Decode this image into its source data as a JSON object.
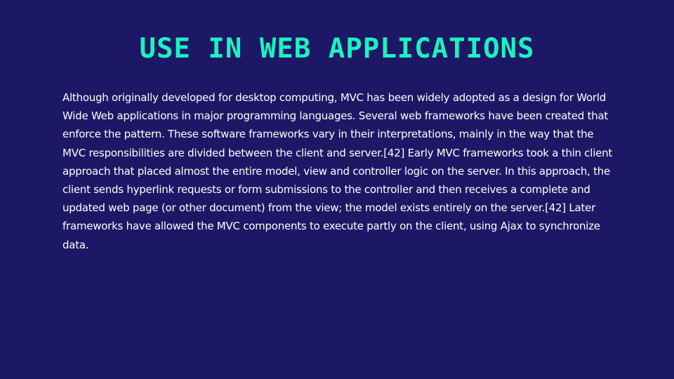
{
  "slide": {
    "title": "USE IN WEB APPLICATIONS",
    "body": "Although originally developed for desktop computing, MVC has been widely adopted as a design for World Wide Web applications in major programming languages. Several web frameworks have been created that enforce the pattern. These software frameworks vary in their interpretations, mainly in the way that the MVC responsibilities are divided between the client and server.[42] Early MVC frameworks took a thin client approach that placed almost the entire model, view and controller logic on the server. In this approach, the client sends hyperlink requests or form submissions to the controller and then receives a complete and updated web page (or other document) from the view; the model exists entirely on the server.[42] Later frameworks have allowed the MVC components to execute partly on the client, using Ajax to synchronize data."
  },
  "colors": {
    "background": "#1d1865",
    "title": "#1cf2c0",
    "body_text": "#ffffff"
  }
}
